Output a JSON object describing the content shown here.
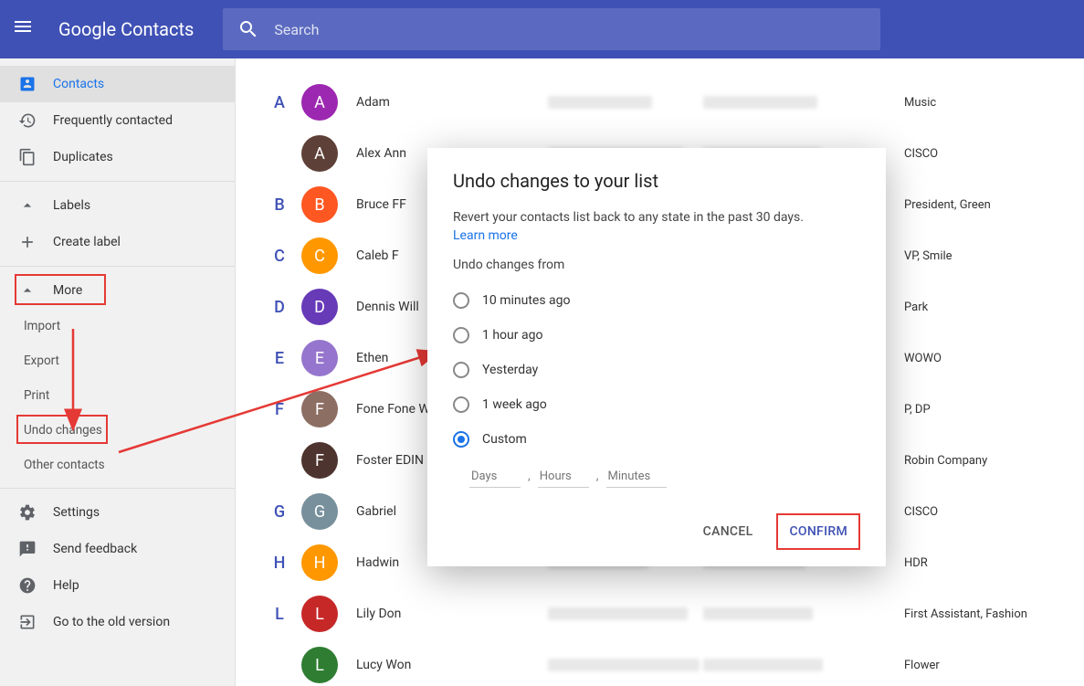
{
  "header": {
    "title": "Google Contacts",
    "search_placeholder": "Search"
  },
  "sidebar": {
    "contacts": "Contacts",
    "frequent": "Frequently contacted",
    "duplicates": "Duplicates",
    "labels": "Labels",
    "create_label": "Create label",
    "more": "More",
    "import": "Import",
    "export": "Export",
    "print": "Print",
    "undo_changes": "Undo changes",
    "other_contacts": "Other contacts",
    "settings": "Settings",
    "send_feedback": "Send feedback",
    "help": "Help",
    "old_version": "Go to the old version"
  },
  "contacts": [
    {
      "letter": "A",
      "initial": "A",
      "color": "#9c27b0",
      "name": "Adam",
      "tag": "Music"
    },
    {
      "letter": "",
      "initial": "A",
      "color": "#5d4037",
      "name": "Alex Ann",
      "tag": "CISCO"
    },
    {
      "letter": "B",
      "initial": "B",
      "color": "#ff5722",
      "name": "Bruce FF",
      "tag": "President, Green"
    },
    {
      "letter": "C",
      "initial": "C",
      "color": "#ff9800",
      "name": "Caleb F",
      "tag": "VP, Smile"
    },
    {
      "letter": "D",
      "initial": "D",
      "color": "#673ab7",
      "name": "Dennis Will",
      "tag": "Park"
    },
    {
      "letter": "E",
      "initial": "E",
      "color": "#9575cd",
      "name": "Ethen",
      "tag": "WOWO"
    },
    {
      "letter": "F",
      "initial": "F",
      "color": "#8d6e63",
      "name": "Fone Fone W",
      "tag": "P, DP"
    },
    {
      "letter": "",
      "initial": "F",
      "color": "#4e342e",
      "name": "Foster EDIN",
      "tag": "Robin Company"
    },
    {
      "letter": "G",
      "initial": "G",
      "color": "#78909c",
      "name": "Gabriel",
      "tag": "CISCO"
    },
    {
      "letter": "H",
      "initial": "H",
      "color": "#ff9800",
      "name": "Hadwin",
      "tag": "HDR"
    },
    {
      "letter": "L",
      "initial": "L",
      "color": "#c62828",
      "name": "Lily Don",
      "tag": "First Assistant, Fashion"
    },
    {
      "letter": "",
      "initial": "L",
      "color": "#2e7d32",
      "name": "Lucy Won",
      "tag": "Flower"
    }
  ],
  "dialog": {
    "title": "Undo changes to your list",
    "desc": "Revert your contacts list back to any state in the past 30 days.",
    "learn_more": "Learn more",
    "sub": "Undo changes from",
    "options": {
      "opt1": "10 minutes ago",
      "opt2": "1 hour ago",
      "opt3": "Yesterday",
      "opt4": "1 week ago",
      "opt5": "Custom"
    },
    "custom": {
      "days": "Days",
      "hours": "Hours",
      "minutes": "Minutes"
    },
    "cancel": "CANCEL",
    "confirm": "CONFIRM"
  }
}
